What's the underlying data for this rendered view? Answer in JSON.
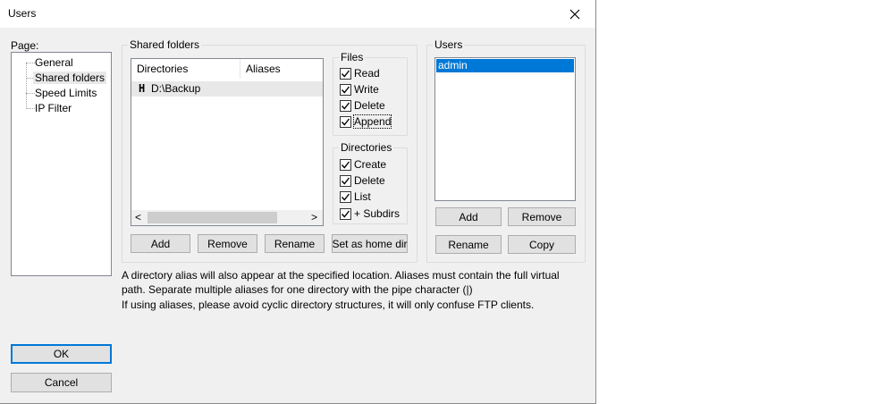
{
  "window": {
    "title": "Users",
    "close_glyph": "✕"
  },
  "page_nav": {
    "label": "Page:",
    "items": [
      {
        "label": "General"
      },
      {
        "label": "Shared folders"
      },
      {
        "label": "Speed Limits"
      },
      {
        "label": "IP Filter"
      }
    ]
  },
  "shared": {
    "group_title": "Shared folders",
    "columns": [
      "Directories",
      "Aliases"
    ],
    "rows": [
      {
        "flag": "H",
        "directory": "D:\\Backup",
        "alias": ""
      }
    ],
    "scroll_left": "<",
    "scroll_right": ">",
    "buttons": {
      "add": "Add",
      "remove": "Remove",
      "rename": "Rename",
      "set_home": "Set as home dir"
    }
  },
  "files": {
    "group_title": "Files",
    "options": [
      {
        "label": "Read",
        "checked": true
      },
      {
        "label": "Write",
        "checked": true
      },
      {
        "label": "Delete",
        "checked": true
      },
      {
        "label": "Append",
        "checked": true
      }
    ]
  },
  "dirs": {
    "group_title": "Directories",
    "options": [
      {
        "label": "Create",
        "checked": true
      },
      {
        "label": "Delete",
        "checked": true
      },
      {
        "label": "List",
        "checked": true
      },
      {
        "label": "+ Subdirs",
        "checked": true
      }
    ]
  },
  "users": {
    "group_title": "Users",
    "list": [
      "admin"
    ],
    "buttons": {
      "add": "Add",
      "remove": "Remove",
      "rename": "Rename",
      "copy": "Copy"
    }
  },
  "info": {
    "line1": "A directory alias will also appear at the specified location. Aliases must contain the full virtual",
    "line2": "path. Separate multiple aliases for one directory with the pipe character (|)",
    "line3": "If using aliases, please avoid cyclic directory structures, it will only confuse FTP clients."
  },
  "footer": {
    "ok": "OK",
    "cancel": "Cancel"
  },
  "colors": {
    "selection": "#0078d7",
    "dialog_bg": "#f0f0f0",
    "focus_border": "#0078d7"
  }
}
